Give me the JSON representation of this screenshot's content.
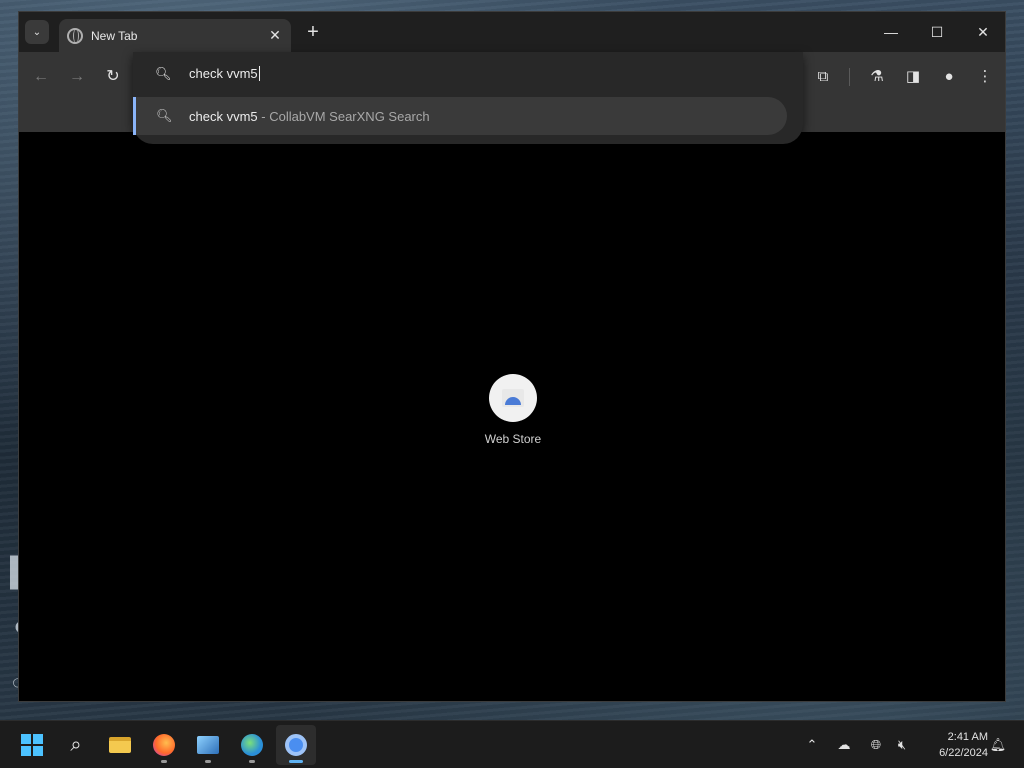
{
  "browser": {
    "tab": {
      "title": "New Tab"
    },
    "window_controls": {
      "minimize": "—",
      "maximize": "☐",
      "close": "✕"
    },
    "new_tab_glyph": "+"
  },
  "omnibox": {
    "value": "check vvm5",
    "suggestions": [
      {
        "query": "check vvm5",
        "separator": " - ",
        "description": "CollabVM SearXNG Search"
      }
    ]
  },
  "page": {
    "shortcuts": [
      {
        "label": "Web Store",
        "icon": "web-store-icon"
      }
    ]
  },
  "taskbar": {
    "apps": [
      "start-icon",
      "search-icon",
      "file-explorer-icon",
      "firefox-icon",
      "vista-app-icon",
      "globe-app-icon",
      "chrome-icon"
    ],
    "clock": {
      "time": "2:41 AM",
      "date": "6/22/2024"
    }
  },
  "colors": {
    "accent": "#8ab4f8",
    "taskbar_active": "#5fb2f2",
    "windows_logo": "#4cc2ff"
  }
}
